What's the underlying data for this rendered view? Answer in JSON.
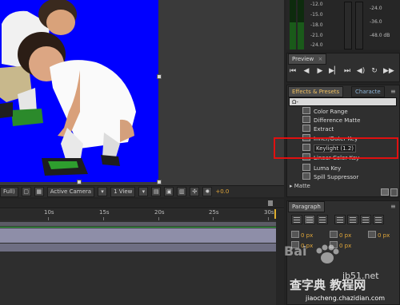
{
  "viewer": {
    "toolbar": {
      "resolution": "Full)",
      "camera": "Active Camera",
      "views": "1 View",
      "exposure": "+0.0"
    }
  },
  "timeline": {
    "ruler_labels": [
      "10s",
      "15s",
      "20s",
      "25s",
      "30s"
    ]
  },
  "meters": {
    "left_labels": [
      "-12.0",
      "-15.0",
      "-18.0",
      "-21.0",
      "-24.0"
    ],
    "right_labels": [
      "-24.0",
      "-36.0",
      "-48.0 dB"
    ]
  },
  "preview": {
    "tab": "Preview",
    "close": "×"
  },
  "effects": {
    "tab": "Effects & Presets",
    "tab2": "Characte",
    "menu_icon": "≡",
    "search_value": "Ω-",
    "items": [
      {
        "label": "Color Range"
      },
      {
        "label": "Difference Matte"
      },
      {
        "label": "Extract"
      },
      {
        "label": "Inner/Outer Key"
      },
      {
        "label": "Keylight (1.2)"
      },
      {
        "label": "Linear Color Key"
      },
      {
        "label": "Luma Key"
      },
      {
        "label": "Spill Suppressor"
      }
    ],
    "category": "▸ Matte"
  },
  "paragraph": {
    "tab": "Paragraph",
    "px_values": [
      "0 px",
      "0 px",
      "0 px",
      "0 px",
      "0 px"
    ]
  },
  "watermark": {
    "baidu": "Bai",
    "site": "jb51.net",
    "name": "查字典 教程网",
    "url": "jiaocheng.chazidian.com"
  },
  "colors": {
    "key_background": "#0000ff",
    "highlight_box": "#e01010",
    "accent_numeric": "#e0a63a"
  }
}
